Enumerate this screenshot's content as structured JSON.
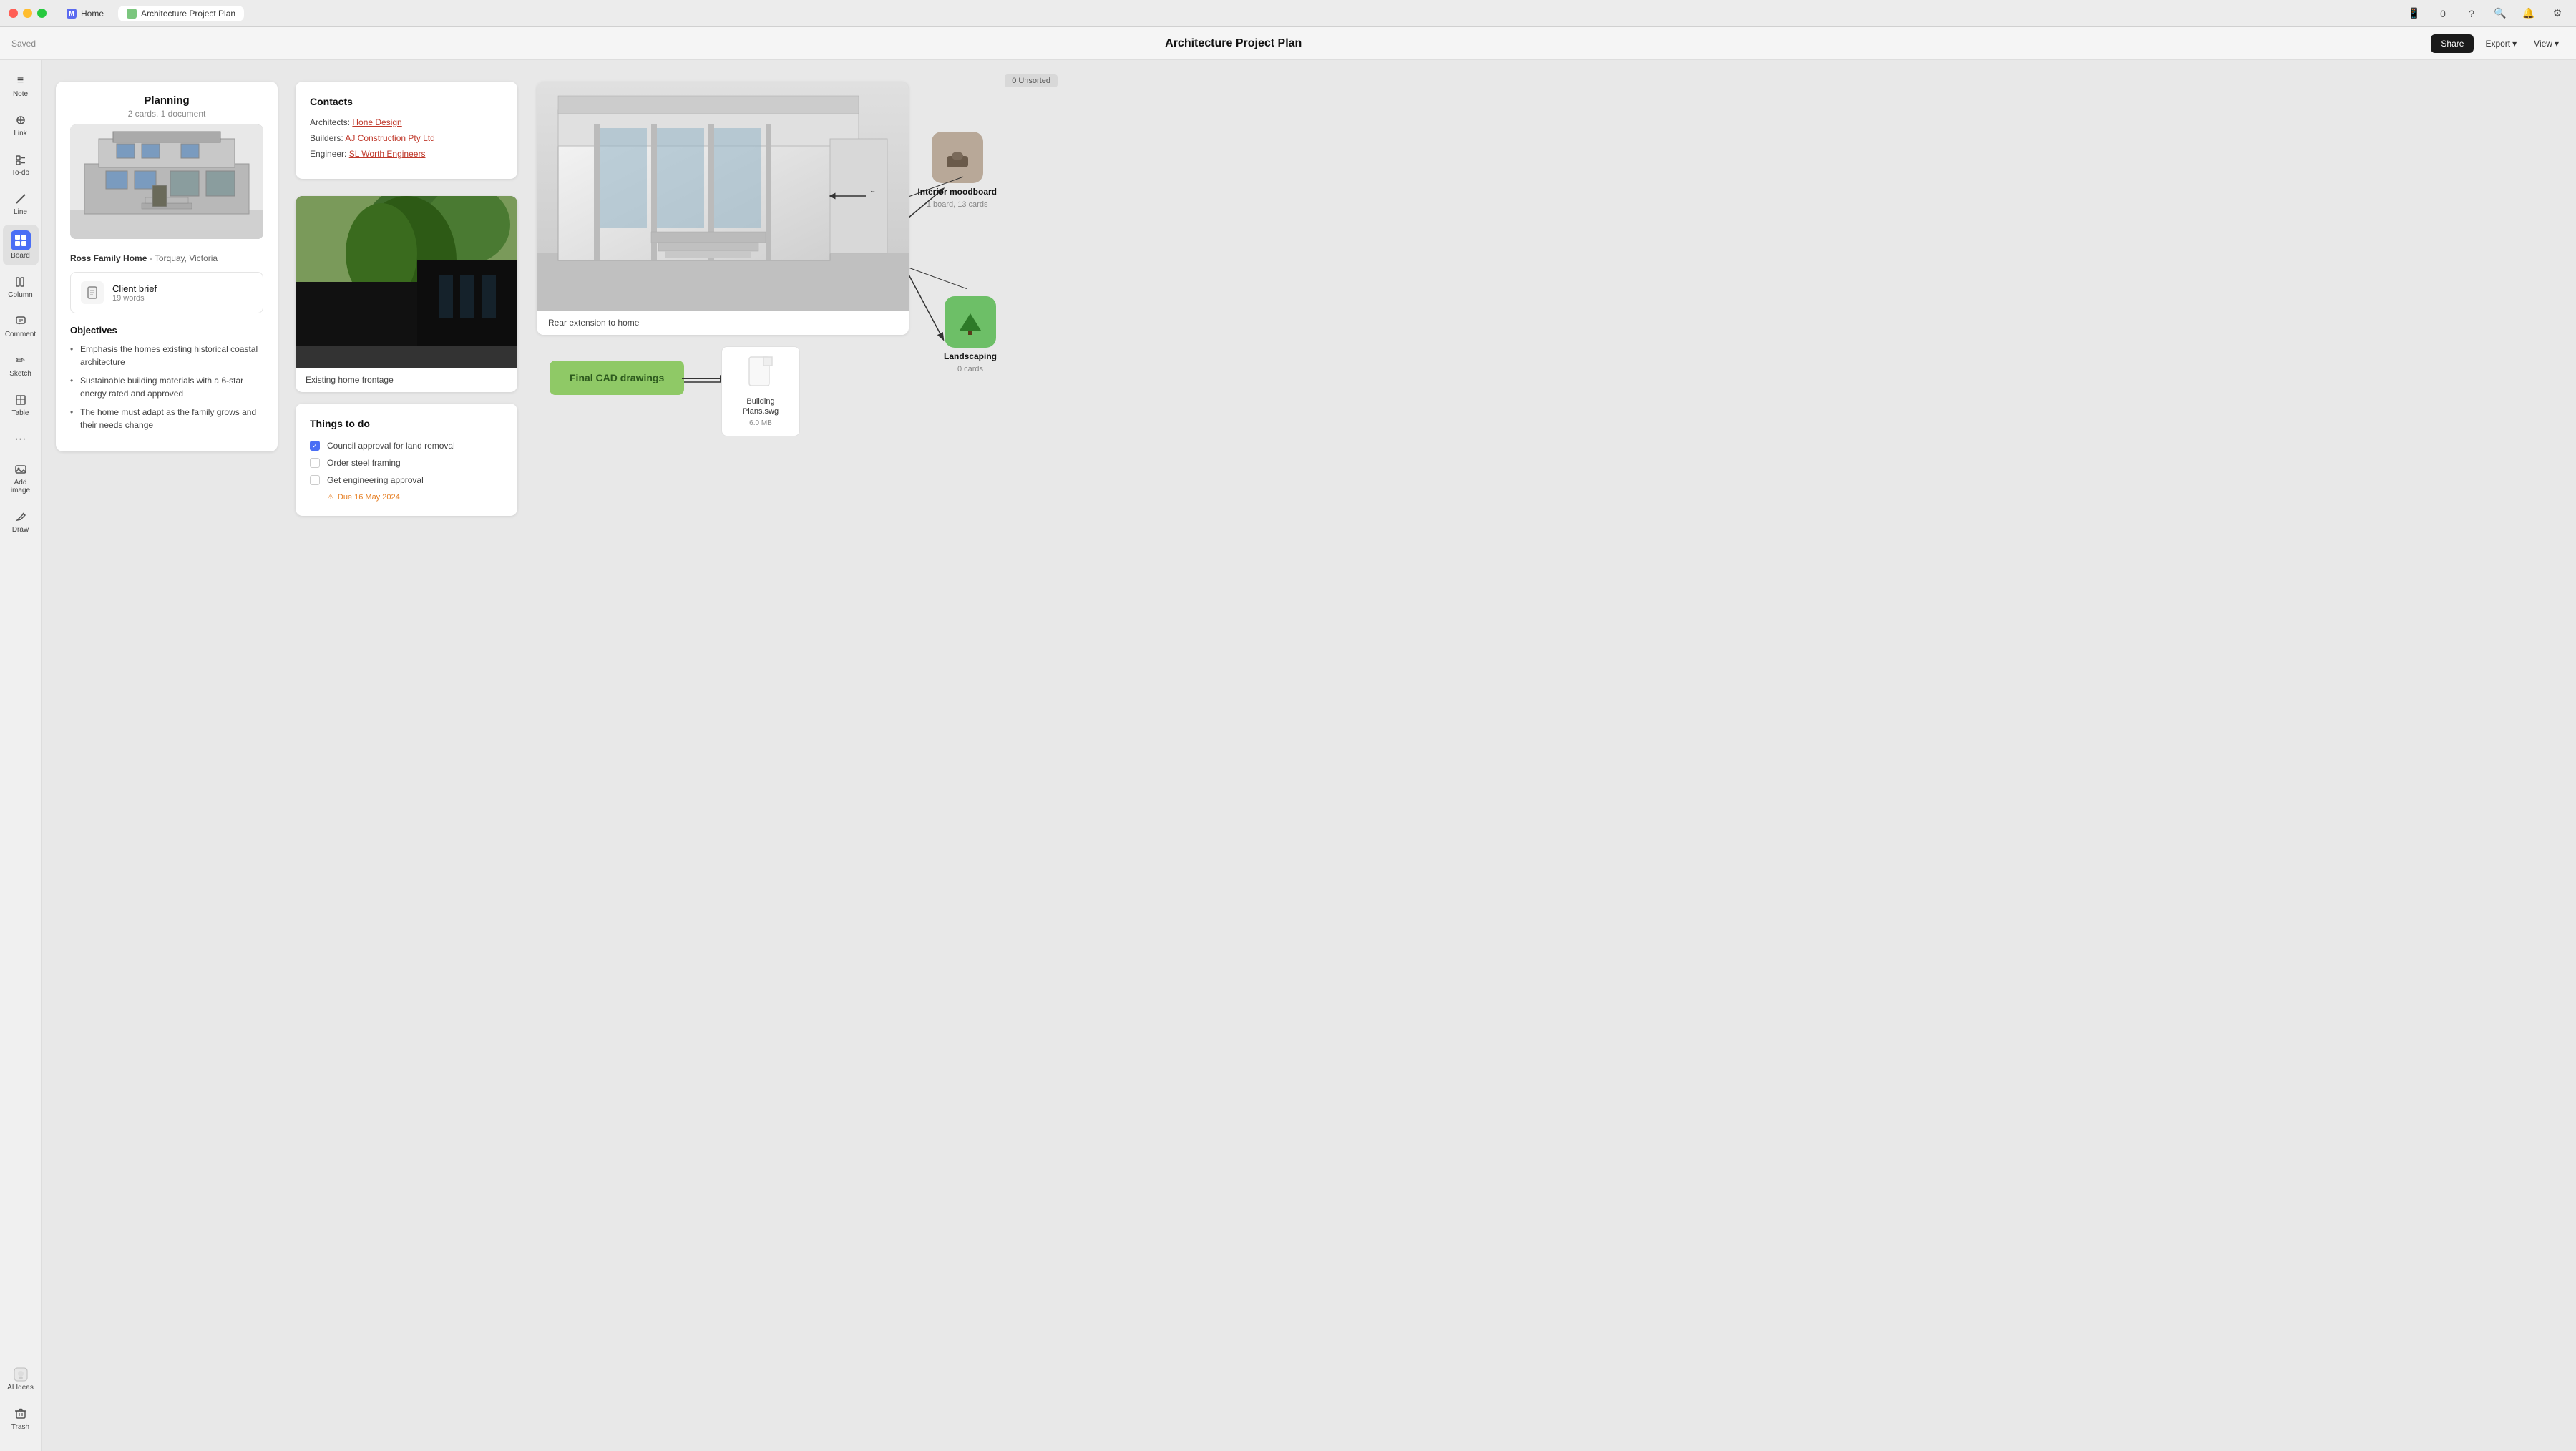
{
  "titlebar": {
    "app_label": "M",
    "home_tab": "Home",
    "active_tab": "Architecture Project Plan"
  },
  "toolbar": {
    "saved_label": "Saved",
    "title": "Architecture Project Plan",
    "share_label": "Share",
    "export_label": "Export",
    "view_label": "View"
  },
  "sidebar": {
    "items": [
      {
        "id": "note",
        "label": "Note",
        "icon": "≡"
      },
      {
        "id": "link",
        "label": "Link",
        "icon": "🔗"
      },
      {
        "id": "todo",
        "label": "To-do",
        "icon": "☑"
      },
      {
        "id": "line",
        "label": "Line",
        "icon": "/"
      },
      {
        "id": "board",
        "label": "Board",
        "icon": "⊞"
      },
      {
        "id": "column",
        "label": "Column",
        "icon": "▤"
      },
      {
        "id": "comment",
        "label": "Comment",
        "icon": "💬"
      },
      {
        "id": "sketch",
        "label": "Sketch",
        "icon": "✏"
      },
      {
        "id": "table",
        "label": "Table",
        "icon": "⊟"
      },
      {
        "id": "more",
        "label": "...",
        "icon": "···"
      },
      {
        "id": "add-image",
        "label": "Add image",
        "icon": "🖼"
      },
      {
        "id": "draw",
        "label": "Draw",
        "icon": "✏"
      }
    ],
    "bottom_items": [
      {
        "id": "ai-ideas",
        "label": "AI Ideas",
        "icon": "💡"
      },
      {
        "id": "trash",
        "label": "Trash",
        "icon": "🗑"
      }
    ]
  },
  "canvas": {
    "unsorted_label": "0 Unsorted",
    "planning_card": {
      "title": "Planning",
      "subtitle": "2 cards, 1 document",
      "house_name": "Ross Family Home",
      "house_location": "Torquay, Victoria",
      "client_brief_title": "Client brief",
      "client_brief_words": "19 words",
      "objectives_title": "Objectives",
      "objectives": [
        "Emphasis the homes existing historical coastal architecture",
        "Sustainable building materials with a 6-star energy rated and approved",
        "The home must adapt as the family grows and their needs change"
      ]
    },
    "contacts_card": {
      "title": "Contacts",
      "architect_label": "Architects:",
      "architect_link": "Hone Design",
      "builder_label": "Builders:",
      "builder_link": "AJ Construction Pty Ltd",
      "engineer_label": "Engineer:",
      "engineer_link": "SL Worth Engineers"
    },
    "frontage_card": {
      "caption": "Existing home frontage"
    },
    "todo_card": {
      "title": "Things to do",
      "items": [
        {
          "text": "Council approval for land removal",
          "checked": true
        },
        {
          "text": "Order steel framing",
          "checked": false
        },
        {
          "text": "Get engineering approval",
          "checked": false
        }
      ],
      "due_label": "Due 16 May 2024"
    },
    "rear_card": {
      "caption": "Rear extension to home"
    },
    "cad_node": {
      "label": "Final CAD drawings"
    },
    "file_node": {
      "name": "Building Plans.swg",
      "size": "6.0 MB"
    },
    "moodboard": {
      "label": "Interior moodboard",
      "subtitle": "1 board, 13 cards"
    },
    "landscaping": {
      "label": "Landscaping",
      "subtitle": "0 cards"
    }
  }
}
